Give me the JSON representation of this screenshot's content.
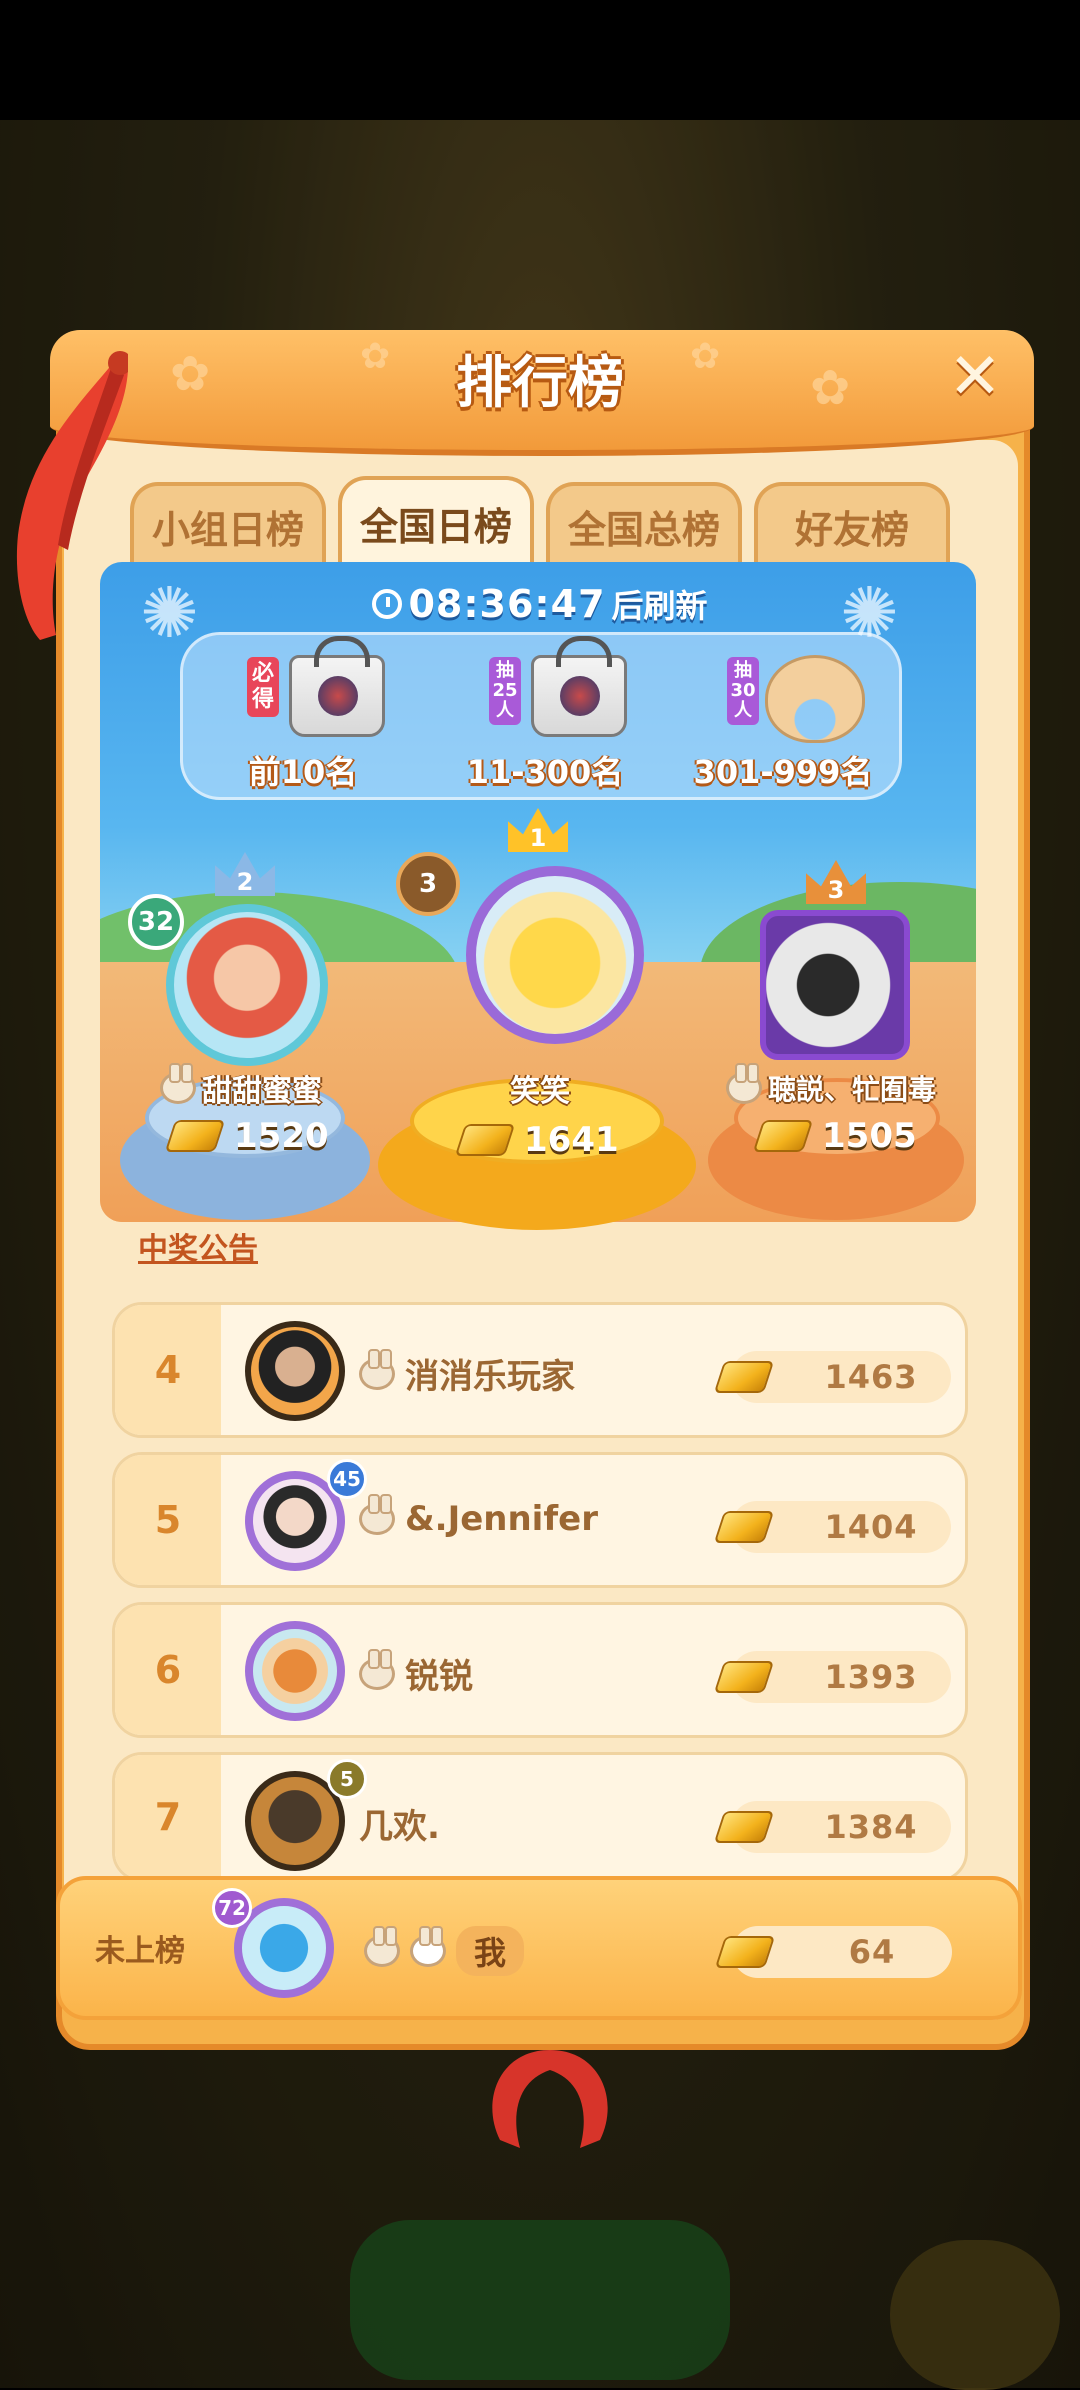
{
  "header": {
    "title": "排行榜"
  },
  "tabs": [
    {
      "label": "小组日榜",
      "active": false
    },
    {
      "label": "全国日榜",
      "active": true
    },
    {
      "label": "全国总榜",
      "active": false
    },
    {
      "label": "好友榜",
      "active": false
    }
  ],
  "timer": {
    "time": "08:36:47",
    "suffix": "后刷新"
  },
  "prizes": [
    {
      "badge": "必得",
      "label": "前10名",
      "icon": "tote-bag-icon"
    },
    {
      "badge": "抽25人",
      "label": "11-300名",
      "icon": "tote-bag-icon"
    },
    {
      "badge": "抽30人",
      "label": "301-999名",
      "icon": "neck-pillow-icon"
    }
  ],
  "podium": {
    "first": {
      "crown": "1",
      "level": "3",
      "name": "笑笑",
      "score": "1641"
    },
    "second": {
      "crown": "2",
      "level": "32",
      "name": "甜甜蜜蜜",
      "score": "1520"
    },
    "third": {
      "crown": "3",
      "name": "聴説、牤囿毒",
      "score": "1505"
    }
  },
  "notice": "中奖公告",
  "rows": [
    {
      "rank": "4",
      "level": "",
      "name": "消消乐玩家",
      "score": "1463"
    },
    {
      "rank": "5",
      "level": "45",
      "name": "&.Jennifer",
      "score": "1404"
    },
    {
      "rank": "6",
      "level": "",
      "name": "锐锐",
      "score": "1393"
    },
    {
      "rank": "7",
      "level": "5",
      "name": "几欢.",
      "score": "1384"
    }
  ],
  "me": {
    "rank": "未上榜",
    "level": "72",
    "name": "我",
    "score": "64"
  },
  "colors": {
    "panel": "#f6b24a",
    "accent": "#e58a2a",
    "sky": "#3d9ee8"
  }
}
